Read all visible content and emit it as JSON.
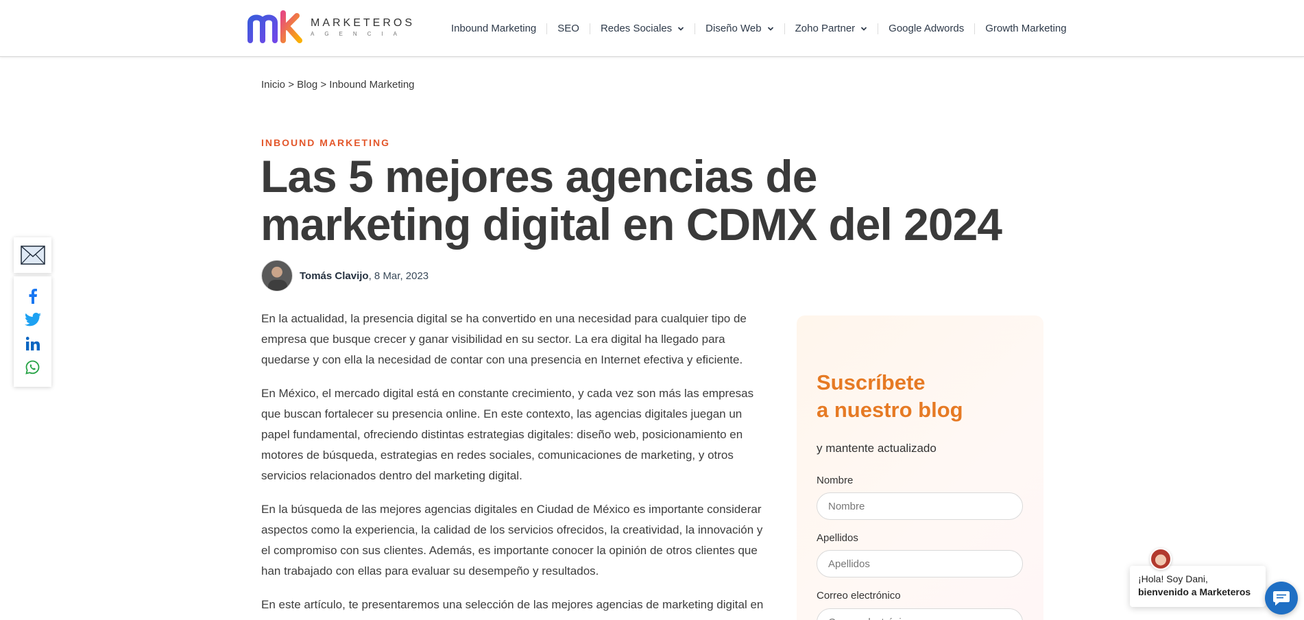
{
  "header": {
    "logo": {
      "name": "MARKETEROS",
      "sub": "AGENCIA"
    },
    "nav": [
      {
        "label": "Inbound Marketing",
        "dropdown": false
      },
      {
        "label": "SEO",
        "dropdown": false
      },
      {
        "label": "Redes Sociales",
        "dropdown": true
      },
      {
        "label": "Diseño Web",
        "dropdown": true
      },
      {
        "label": "Zoho Partner",
        "dropdown": true
      },
      {
        "label": "Google Adwords",
        "dropdown": false
      },
      {
        "label": "Growth Marketing",
        "dropdown": false
      }
    ]
  },
  "breadcrumb": {
    "home": "Inicio",
    "sep": ">",
    "blog": "Blog",
    "current": "Inbound Marketing"
  },
  "article": {
    "category": "INBOUND MARKETING",
    "title": "Las 5 mejores agencias de marketing digital en CDMX del 2024",
    "author": "Tomás Clavijo",
    "date": ", 8 Mar, 2023",
    "paragraphs": [
      "En la actualidad, la presencia digital se ha convertido en una necesidad para cualquier  tipo de empresa que busque crecer y ganar visibilidad en su sector. La era digital ha llegado para quedarse y con ella la necesidad de contar con una presencia en Internet efectiva y eficiente.",
      "En México, el mercado digital está en constante crecimiento, y cada vez son más las empresas que buscan fortalecer su presencia online. En este contexto, las agencias digitales juegan un papel fundamental, ofreciendo distintas estrategias digitales: diseño web, posicionamiento en motores de búsqueda, estrategias en redes sociales, comunicaciones de marketing, y otros servicios relacionados dentro del marketing digital.",
      "En la búsqueda de las mejores agencias digitales en Ciudad de México es importante considerar aspectos como la experiencia, la calidad de los servicios ofrecidos, la creatividad, la innovación y el compromiso con sus clientes. Además, es importante conocer la opinión de otros clientes que han trabajado con ellas para evaluar su desempeño y resultados.",
      "En este artículo, te presentaremos una selección de las mejores agencias de marketing digital en"
    ]
  },
  "share": {
    "icons": [
      "mail-icon",
      "facebook-icon",
      "twitter-icon",
      "linkedin-icon",
      "whatsapp-icon"
    ]
  },
  "subscribe": {
    "title_line1": "Suscríbete",
    "title_line2": "a nuestro blog",
    "subtitle": "y mantente actualizado",
    "fields": [
      {
        "label": "Nombre",
        "placeholder": "Nombre"
      },
      {
        "label": "Apellidos",
        "placeholder": "Apellidos"
      },
      {
        "label": "Correo electrónico",
        "placeholder": "Correo electrónico"
      }
    ],
    "accent_color": "#e67a24"
  },
  "chat": {
    "greeting": "¡Hola! Soy Dani,",
    "welcome": "bienvenido a Marketeros",
    "launcher_color": "#1f6fc4"
  },
  "colors": {
    "category": "#e3572b",
    "title": "#3a3a3a",
    "facebook": "#1877f2",
    "twitter": "#1da1f2",
    "linkedin": "#0a66c2",
    "whatsapp": "#25a244"
  }
}
